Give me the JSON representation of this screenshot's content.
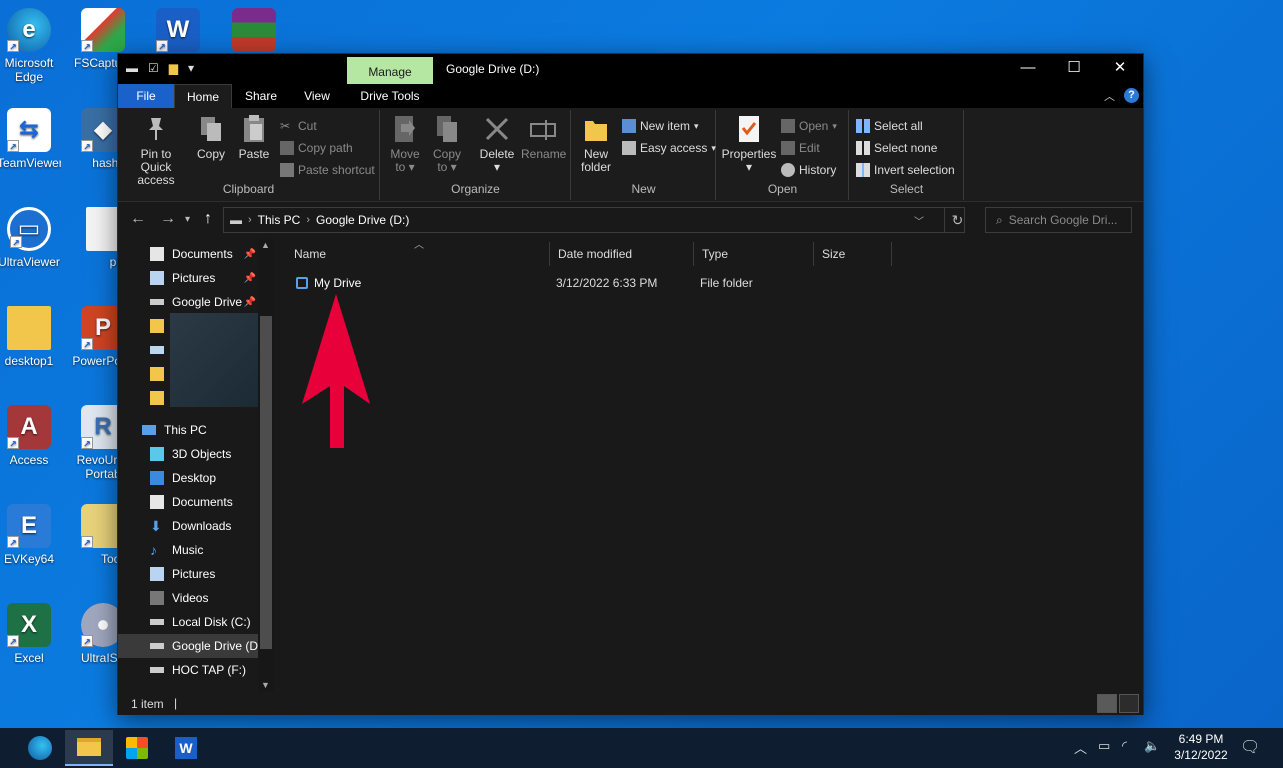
{
  "desktop": {
    "icons": [
      {
        "label": "Microsoft Edge",
        "label2": "Edge",
        "label1": "Microsoft",
        "color": "#1a8fd6"
      },
      {
        "label": "FSCapture",
        "color": "#e23a2e"
      },
      {
        "label": "TeamViewer",
        "color": "#1a66d8"
      },
      {
        "label": "hashes",
        "color": "#3a7ab5"
      },
      {
        "label": "UltraViewer",
        "color": "#1a6fd0"
      },
      {
        "label": "plot",
        "color": "#ffffff"
      },
      {
        "label": "desktop1",
        "color": "#f2c64a"
      },
      {
        "label": "PowerPoint",
        "color": "#d04423"
      },
      {
        "label": "Access",
        "color": "#a4373a"
      },
      {
        "label": "RevoUninstaller Portable",
        "label1": "RevoUnin",
        "label2": "Portab",
        "color": "#3a6fb5"
      },
      {
        "label": "EVKey64",
        "color": "#2a7ad8"
      },
      {
        "label": "Tools",
        "color": "#e8d27a"
      },
      {
        "label": "Excel",
        "color": "#1e7145"
      },
      {
        "label": "UltraISO",
        "color": "#888888"
      }
    ]
  },
  "window": {
    "title": "Google Drive (D:)",
    "manage_tab": "Manage",
    "tabs": {
      "file": "File",
      "home": "Home",
      "share": "Share",
      "view": "View",
      "drive_tools": "Drive Tools"
    },
    "help": "?",
    "controls": {
      "minimize": "—",
      "maximize": "☐",
      "close": "✕"
    }
  },
  "ribbon": {
    "clipboard": {
      "label": "Clipboard",
      "pin_line1": "Pin to Quick",
      "pin_line2": "access",
      "copy": "Copy",
      "paste": "Paste",
      "cut": "Cut",
      "copy_path": "Copy path",
      "paste_shortcut": "Paste shortcut"
    },
    "organize": {
      "label": "Organize",
      "move_to_1": "Move",
      "move_to_2": "to",
      "copy_to_1": "Copy",
      "copy_to_2": "to",
      "delete": "Delete",
      "rename": "Rename"
    },
    "new": {
      "label": "New",
      "new_folder_1": "New",
      "new_folder_2": "folder",
      "new_item": "New item",
      "easy_access": "Easy access"
    },
    "open": {
      "label": "Open",
      "properties": "Properties",
      "open": "Open",
      "edit": "Edit",
      "history": "History"
    },
    "select": {
      "label": "Select",
      "select_all": "Select all",
      "select_none": "Select none",
      "invert_selection": "Invert selection"
    }
  },
  "address": {
    "crumbs": [
      "This PC",
      "Google Drive (D:)"
    ],
    "search_placeholder": "Search Google Dri..."
  },
  "nav": {
    "quick": [
      {
        "label": "Documents",
        "pinned": true
      },
      {
        "label": "Pictures",
        "pinned": true
      },
      {
        "label": "Google Drive",
        "pinned": true
      }
    ],
    "this_pc": "This PC",
    "pc_items": [
      "3D Objects",
      "Desktop",
      "Documents",
      "Downloads",
      "Music",
      "Pictures",
      "Videos",
      "Local Disk (C:)",
      "Google Drive (D:)",
      "HOC TAP (F:)"
    ],
    "selected": "Google Drive (D:)"
  },
  "columns": {
    "name": "Name",
    "date": "Date modified",
    "type": "Type",
    "size": "Size"
  },
  "files": [
    {
      "name": "My Drive",
      "date": "3/12/2022 6:33 PM",
      "type": "File folder",
      "size": ""
    }
  ],
  "status": {
    "count": "1 item"
  },
  "taskbar": {
    "time": "6:49 PM",
    "date": "3/12/2022"
  },
  "colors": {
    "accent": "#1a62c9",
    "manage": "#b5e6a2",
    "arrow": "#e8003a"
  }
}
